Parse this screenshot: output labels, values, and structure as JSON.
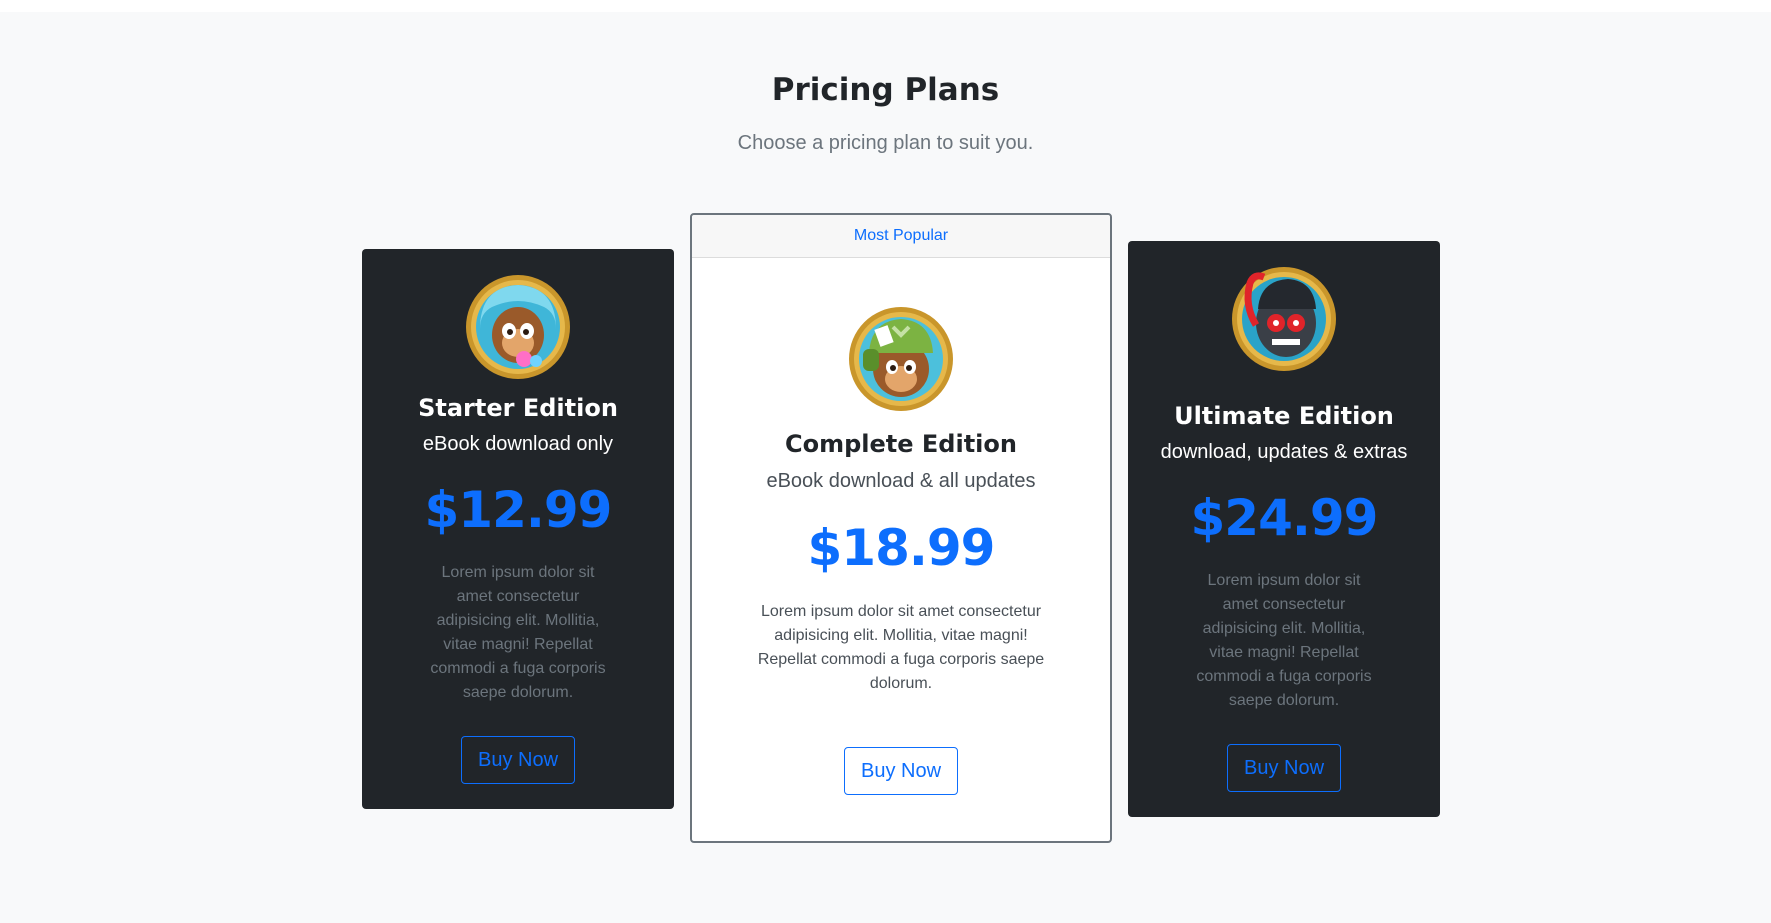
{
  "header": {
    "title": "Pricing Plans",
    "subtitle": "Choose a pricing plan to suit you."
  },
  "plans": [
    {
      "name": "Starter Edition",
      "tagline": "eBook download only",
      "price": "$12.99",
      "description": "Lorem ipsum dolor sit amet consectetur adipisicing elit. Mollitia, vitae magni! Repellat commodi a fuga corporis saepe dolorum.",
      "button_label": "Buy Now",
      "avatar_icon": "baby-monkey-hero-icon",
      "theme": "dark"
    },
    {
      "badge": "Most Popular",
      "name": "Complete Edition",
      "tagline": "eBook download & all updates",
      "price": "$18.99",
      "description": "Lorem ipsum dolor sit amet consectetur adipisicing elit. Mollitia, vitae magni! Repellat commodi a fuga corporis saepe dolorum.",
      "button_label": "Buy Now",
      "avatar_icon": "soldier-monkey-hero-icon",
      "theme": "light"
    },
    {
      "name": "Ultimate Edition",
      "tagline": "download, updates & extras",
      "price": "$24.99",
      "description": "Lorem ipsum dolor sit amet consectetur adipisicing elit. Mollitia, vitae magni! Repellat commodi a fuga corporis saepe dolorum.",
      "button_label": "Buy Now",
      "avatar_icon": "robot-monkey-hero-icon",
      "theme": "dark"
    }
  ],
  "colors": {
    "accent": "#0d6efd",
    "dark_card": "#212529",
    "page_background": "#f8f9fa"
  }
}
